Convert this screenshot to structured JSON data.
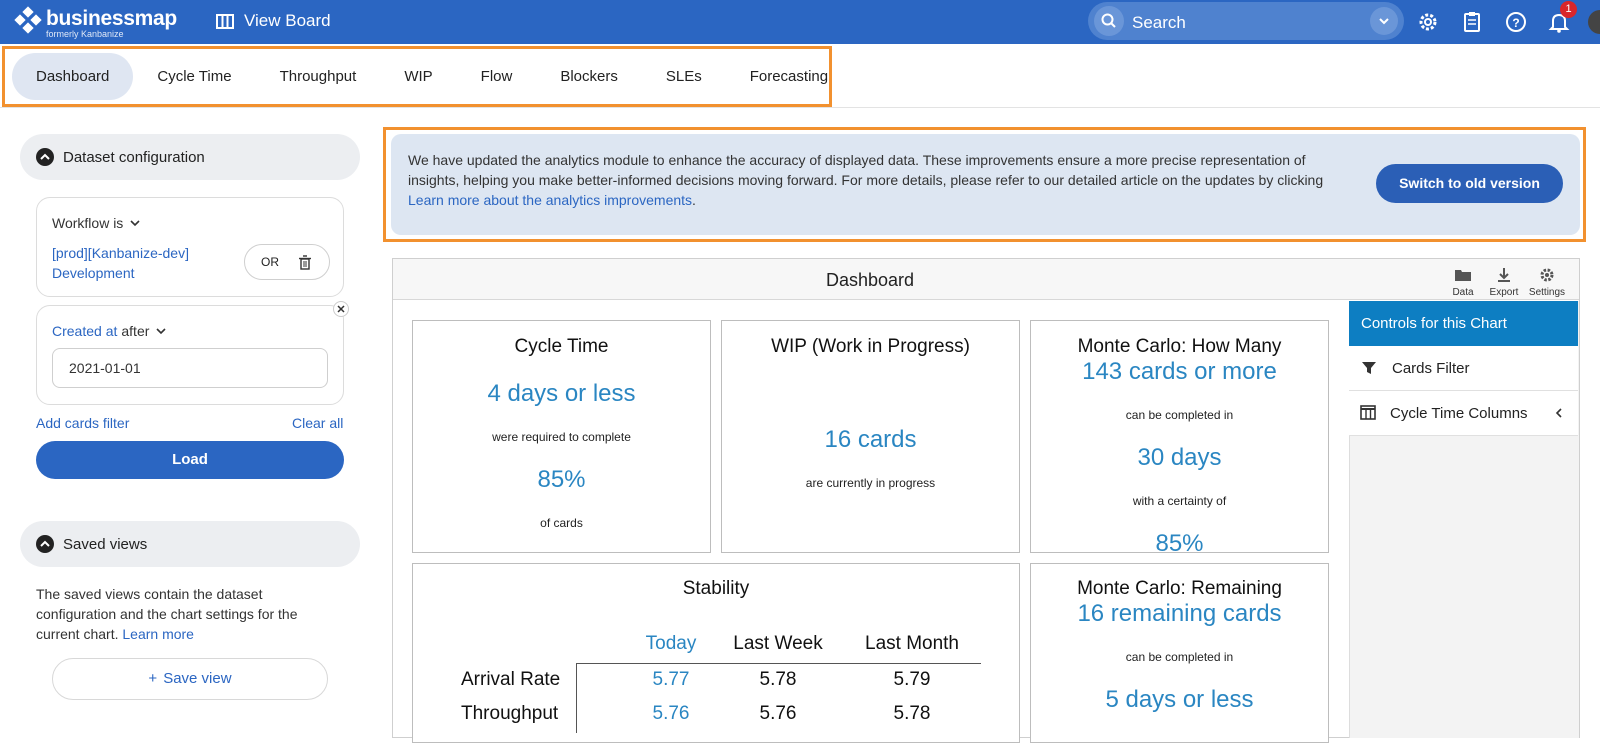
{
  "topbar": {
    "logo_name": "businessmap",
    "logo_sub": "formerly Kanbanize",
    "view_board": "View Board",
    "search_placeholder": "Search",
    "notification_count": "1"
  },
  "tabs": [
    "Dashboard",
    "Cycle Time",
    "Throughput",
    "WIP",
    "Flow",
    "Blockers",
    "SLEs",
    "Forecasting"
  ],
  "sidebar": {
    "dataset_title": "Dataset configuration",
    "workflow_label": "Workflow is",
    "workflow_value": "[prod][Kanbanize-dev] Development",
    "or_label": "OR",
    "created_label": "Created at",
    "created_op": "after",
    "created_value": "2021-01-01",
    "add_filter": "Add cards filter",
    "clear_all": "Clear all",
    "load": "Load",
    "saved_title": "Saved views",
    "saved_desc": "The saved views contain the dataset configuration and the chart settings for the current chart.",
    "learn_more": "Learn more",
    "save_view": "Save view"
  },
  "banner": {
    "text": "We have updated the analytics module to enhance the accuracy of displayed data. These improvements ensure a more precise representation of insights, helping you make better-informed decisions moving forward. For more details, please refer to our detailed article on the updates by clicking",
    "link": "Learn more about the analytics improvements",
    "end": ".",
    "button": "Switch to old version"
  },
  "dashboard": {
    "title": "Dashboard",
    "tools": [
      "Data",
      "Export",
      "Settings"
    ],
    "cycle_time": {
      "title": "Cycle Time",
      "value": "4 days or less",
      "mid": "were required to complete",
      "pct": "85%",
      "tail": "of cards"
    },
    "wip": {
      "title": "WIP (Work in Progress)",
      "value": "16 cards",
      "tail": "are currently in progress"
    },
    "mc_many": {
      "title": "Monte Carlo: How Many",
      "value": "143 cards or more",
      "mid": "can be completed in",
      "days": "30 days",
      "mid2": "with a certainty of",
      "pct": "85%"
    },
    "stability": {
      "title": "Stability",
      "columns": [
        "Today",
        "Last Week",
        "Last Month"
      ],
      "rows": [
        {
          "label": "Arrival Rate",
          "values": [
            "5.77",
            "5.78",
            "5.79"
          ]
        },
        {
          "label": "Throughput",
          "values": [
            "5.76",
            "5.76",
            "5.78"
          ]
        }
      ]
    },
    "mc_remaining": {
      "title": "Monte Carlo: Remaining",
      "value": "16 remaining cards",
      "mid": "can be completed in",
      "days": "5 days or less"
    }
  },
  "controls": {
    "title": "Controls for this Chart",
    "items": [
      "Cards Filter",
      "Cycle Time Columns"
    ]
  }
}
